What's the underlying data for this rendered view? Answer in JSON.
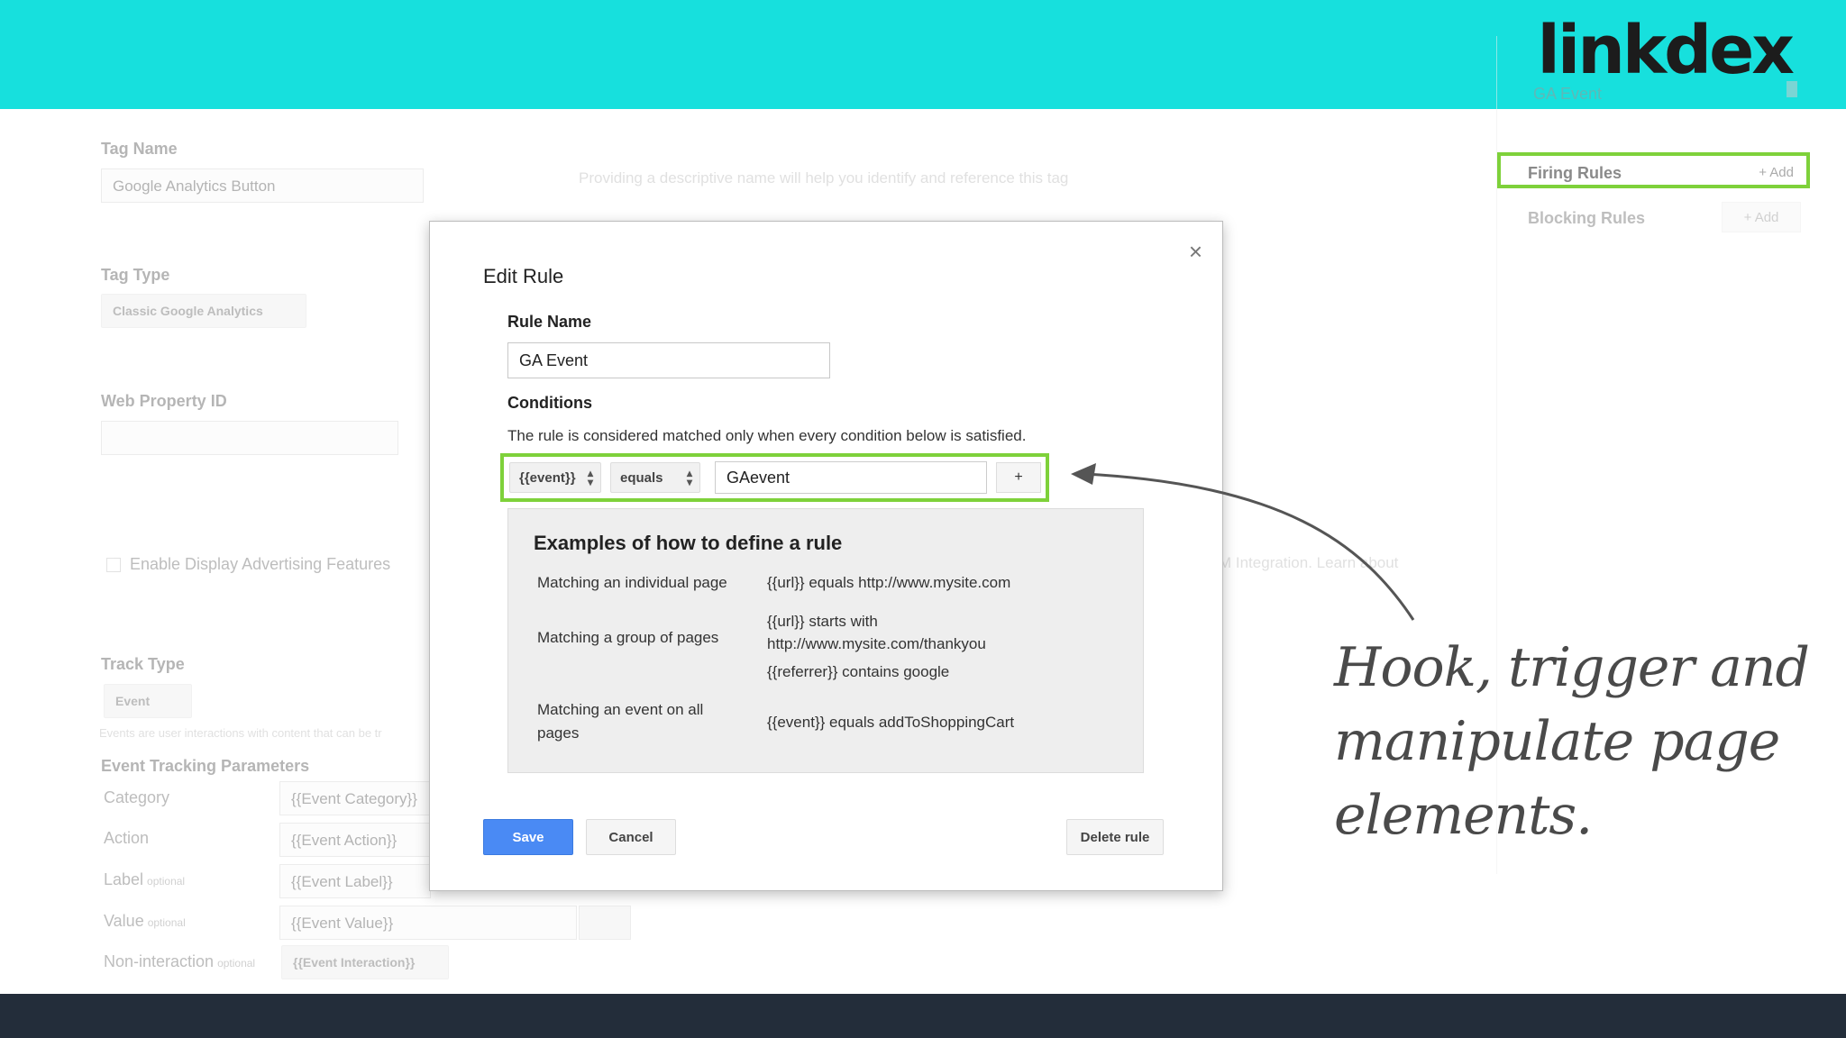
{
  "brand": {
    "logo_text": "linkdex",
    "accent": "#17e0dd",
    "highlight": "#7ed13a",
    "footer_color": "#232d3a"
  },
  "background_form": {
    "tag_name_label": "Tag Name",
    "tag_name_value": "Google Analytics Button",
    "tag_name_hint": "Providing a descriptive name will help you identify and reference this tag",
    "tag_type_label": "Tag Type",
    "tag_type_value": "Classic Google Analytics",
    "web_property_label": "Web Property ID",
    "display_features_label": "Enable Display Advertising Features",
    "crm_fragment": "M Integration.  Learn about",
    "track_type_label": "Track Type",
    "track_type_value": "Event",
    "events_hint": "Events are user interactions with content that can be tr",
    "event_params_label": "Event Tracking Parameters",
    "params": [
      {
        "label": "Category",
        "optional": "",
        "value": "{{Event Category}}"
      },
      {
        "label": "Action",
        "optional": "",
        "value": "{{Event Action}}"
      },
      {
        "label": "Label",
        "optional": "optional",
        "value": "{{Event Label}}"
      },
      {
        "label": "Value",
        "optional": "optional",
        "value": "{{Event Value}}"
      },
      {
        "label": "Non-interaction",
        "optional": "optional",
        "value": "{{Event Interaction}}"
      }
    ]
  },
  "sidebar": {
    "firing_rules_label": "Firing Rules",
    "firing_add": "+ Add",
    "firing_item": "GA Event",
    "blocking_rules_label": "Blocking Rules",
    "blocking_add": "+ Add"
  },
  "modal": {
    "title": "Edit Rule",
    "close": "×",
    "rule_name_label": "Rule Name",
    "rule_name_value": "GA Event",
    "conditions_label": "Conditions",
    "conditions_desc": "The rule is considered matched only when every condition below is satisfied.",
    "condition": {
      "variable": "{{event}}",
      "operator": "equals",
      "value": "GAevent",
      "add": "+"
    },
    "examples": {
      "title": "Examples of how to define a rule",
      "row1_label": "Matching an individual page",
      "row1_value": "{{url}} equals http://www.mysite.com",
      "row2_label": "Matching a group of pages",
      "row2_value_a": "{{url}} starts with",
      "row2_value_b": "http://www.mysite.com/thankyou",
      "row2_value_c": "{{referrer}} contains google",
      "row3_label_a": "Matching an event on all",
      "row3_label_b": "pages",
      "row3_value": "{{event}} equals addToShoppingCart"
    },
    "save": "Save",
    "cancel": "Cancel",
    "delete": "Delete rule"
  },
  "annotation": {
    "line1": "Hook, trigger and",
    "line2": "manipulate page",
    "line3": "elements."
  }
}
